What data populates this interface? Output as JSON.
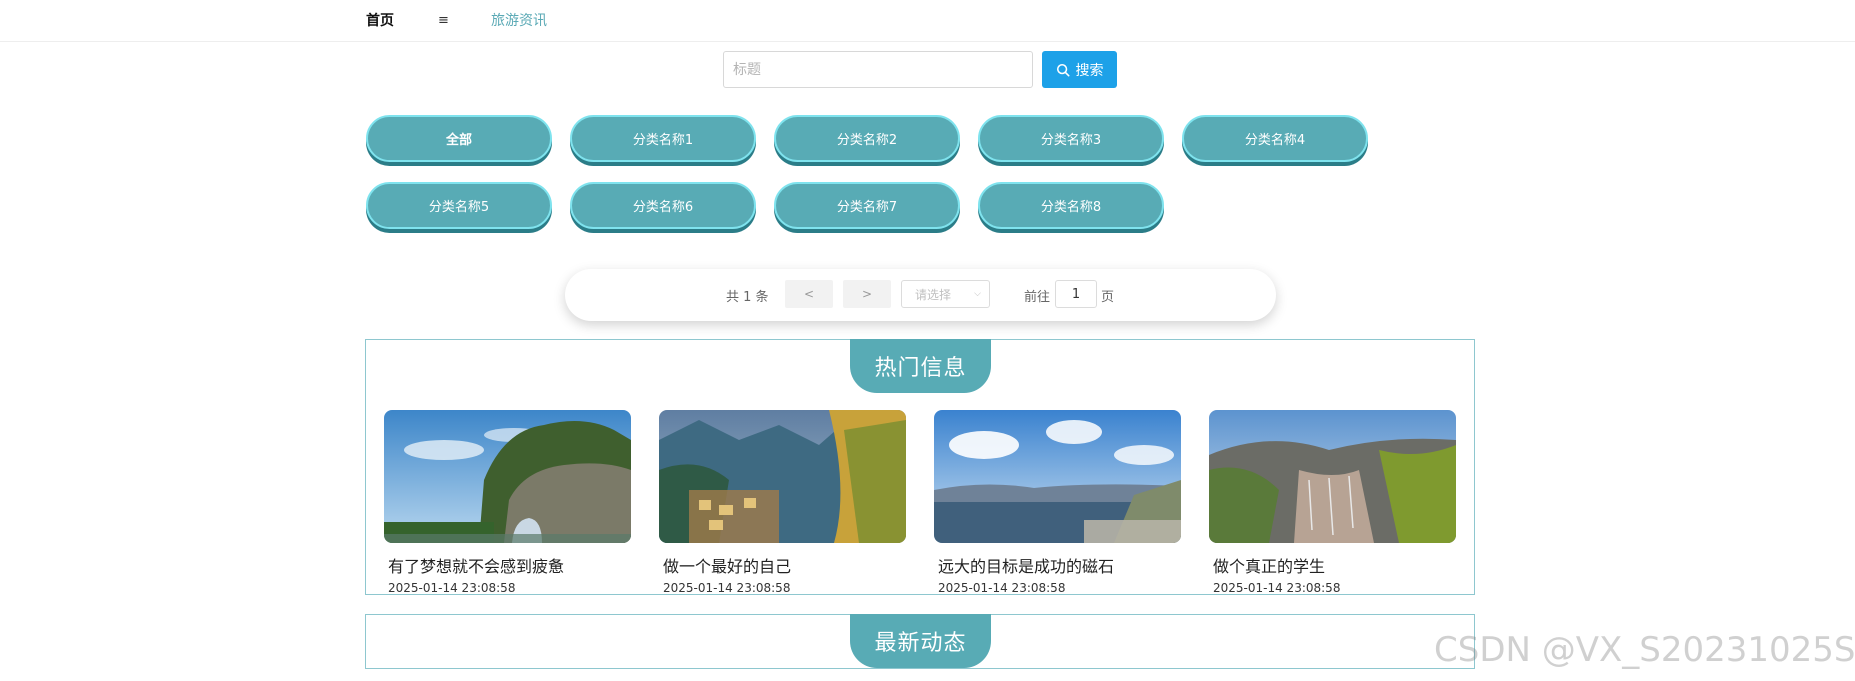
{
  "nav": {
    "home": "首页",
    "menu_icon": "≡",
    "news": "旅游资讯"
  },
  "search": {
    "placeholder": "标题",
    "value": "",
    "button_label": "搜索"
  },
  "categories": [
    {
      "label": "全部",
      "active": true
    },
    {
      "label": "分类名称1"
    },
    {
      "label": "分类名称2"
    },
    {
      "label": "分类名称3"
    },
    {
      "label": "分类名称4"
    },
    {
      "label": "分类名称5"
    },
    {
      "label": "分类名称6"
    },
    {
      "label": "分类名称7"
    },
    {
      "label": "分类名称8"
    }
  ],
  "pagination": {
    "total": "共 1 条",
    "prev": "<",
    "next": ">",
    "size_select_placeholder": "请选择",
    "goto_label": "前往",
    "page": "1",
    "page_unit": "页"
  },
  "hot": {
    "title": "热门信息",
    "items": [
      {
        "title": "有了梦想就不会感到疲惫",
        "time": "2025-01-14 23:08:58",
        "image": "karst-mountain-river"
      },
      {
        "title": "做一个最好的自己",
        "time": "2025-01-14 23:08:58",
        "image": "cliff-village-valley"
      },
      {
        "title": "远大的目标是成功的磁石",
        "time": "2025-01-14 23:08:58",
        "image": "lake-clouds-town"
      },
      {
        "title": "做个真正的学生",
        "time": "2025-01-14 23:08:58",
        "image": "mountain-canyon"
      }
    ]
  },
  "latest": {
    "title": "最新动态"
  },
  "watermark": "CSDN @VX_S20231025S",
  "colors": {
    "accent": "#58abb5",
    "search_button": "#1da1e8",
    "nav_link": "#5aa9b5",
    "section_border": "#8ec7cf"
  }
}
